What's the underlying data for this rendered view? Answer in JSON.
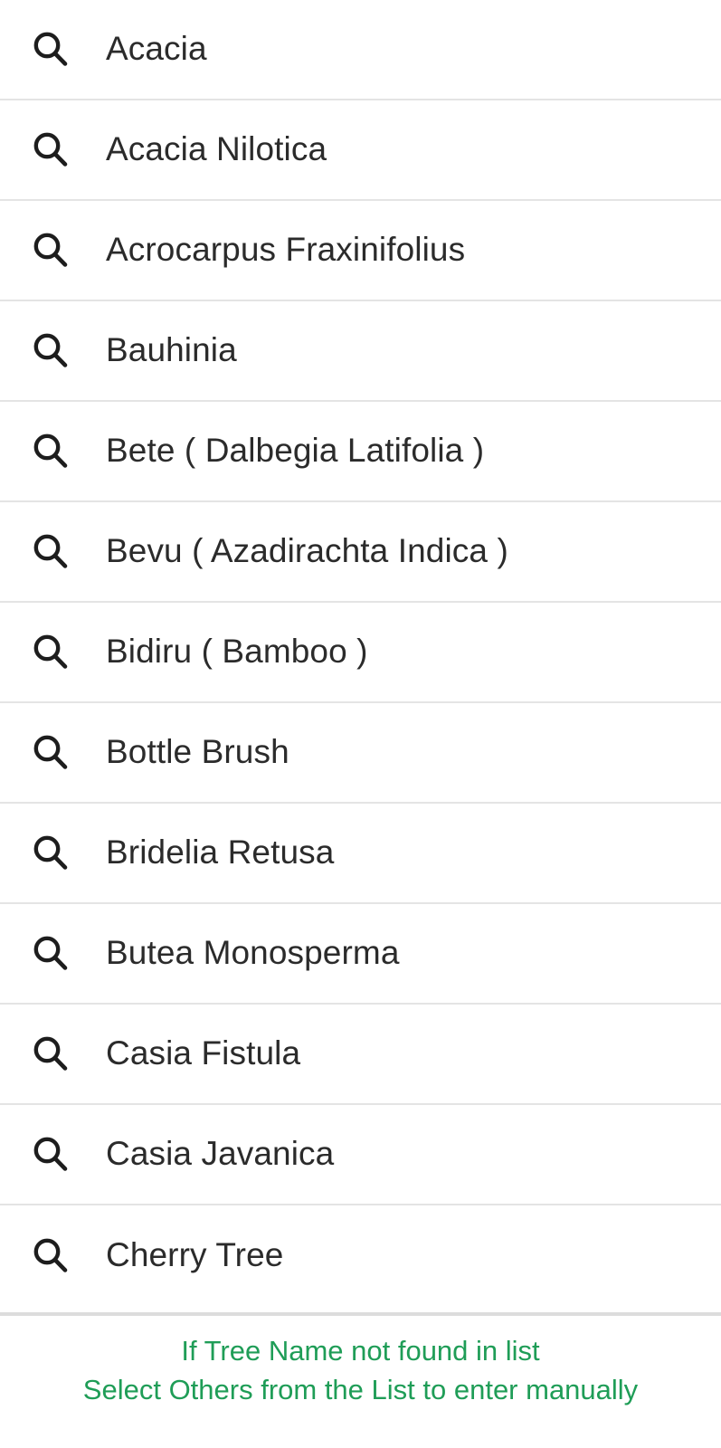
{
  "screen": {
    "name": "tree-name-search-suggestions",
    "background": "#ffffff",
    "divider_color": "#e4e4e4",
    "footer_divider_color": "#dcdcdc",
    "text_color": "#2b2b2b",
    "accent_green": "#1f9d57"
  },
  "suggestions": {
    "icon_name": "search-icon",
    "items": [
      {
        "label": "Acacia"
      },
      {
        "label": "Acacia Nilotica"
      },
      {
        "label": "Acrocarpus Fraxinifolius"
      },
      {
        "label": "Bauhinia"
      },
      {
        "label": "Bete ( Dalbegia Latifolia )"
      },
      {
        "label": "Bevu ( Azadirachta Indica )"
      },
      {
        "label": "Bidiru ( Bamboo )"
      },
      {
        "label": "Bottle Brush"
      },
      {
        "label": "Bridelia Retusa"
      },
      {
        "label": "Butea Monosperma"
      },
      {
        "label": "Casia Fistula"
      },
      {
        "label": "Casia Javanica"
      },
      {
        "label": "Cherry Tree"
      }
    ]
  },
  "footer": {
    "line1": "If Tree Name not found in list",
    "line2": "Select Others from the List to enter manually"
  }
}
